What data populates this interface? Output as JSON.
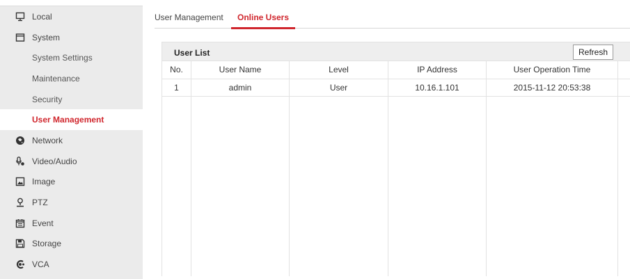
{
  "sidebar": {
    "items": [
      {
        "label": "Local",
        "icon": "monitor-icon",
        "level": "top"
      },
      {
        "label": "System",
        "icon": "system-icon",
        "level": "top"
      },
      {
        "label": "System Settings",
        "level": "sub"
      },
      {
        "label": "Maintenance",
        "level": "sub"
      },
      {
        "label": "Security",
        "level": "sub"
      },
      {
        "label": "User Management",
        "level": "sub",
        "active": true
      },
      {
        "label": "Network",
        "icon": "network-icon",
        "level": "top"
      },
      {
        "label": "Video/Audio",
        "icon": "video-audio-icon",
        "level": "top"
      },
      {
        "label": "Image",
        "icon": "image-icon",
        "level": "top"
      },
      {
        "label": "PTZ",
        "icon": "ptz-icon",
        "level": "top"
      },
      {
        "label": "Event",
        "icon": "event-icon",
        "level": "top"
      },
      {
        "label": "Storage",
        "icon": "storage-icon",
        "level": "top"
      },
      {
        "label": "VCA",
        "icon": "vca-icon",
        "level": "top"
      }
    ]
  },
  "tabs": [
    {
      "label": "User Management",
      "active": false
    },
    {
      "label": "Online Users",
      "active": true
    }
  ],
  "panel": {
    "title": "User List",
    "refresh_label": "Refresh"
  },
  "table": {
    "headers": [
      "No.",
      "User Name",
      "Level",
      "IP Address",
      "User Operation Time",
      ""
    ],
    "rows": [
      [
        "1",
        "admin",
        "User",
        "10.16.1.101",
        "2015-11-12 20:53:38",
        ""
      ]
    ]
  },
  "colors": {
    "accent": "#d0262d",
    "sidebar_bg": "#ebebeb",
    "header_bg": "#eeeeee"
  }
}
